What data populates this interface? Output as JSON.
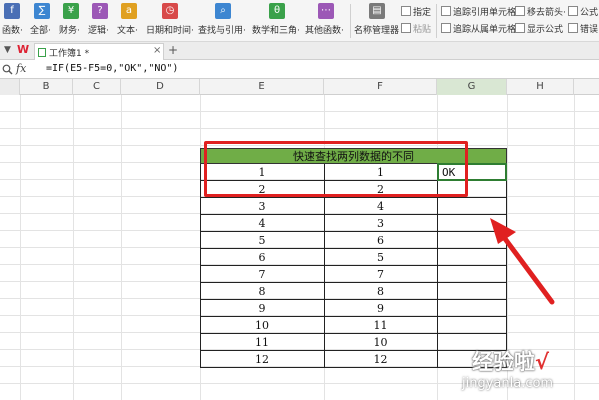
{
  "ribbon": {
    "buttons": [
      {
        "label": "函数·",
        "icon": "function-icon",
        "color": "#4a6fb5"
      },
      {
        "label": "全部·",
        "icon": "all-functions-icon",
        "color": "#3d86d1"
      },
      {
        "label": "财务·",
        "icon": "finance-icon",
        "color": "#3aa14a"
      },
      {
        "label": "逻辑·",
        "icon": "logic-icon",
        "color": "#9c58b6"
      },
      {
        "label": "文本·",
        "icon": "text-icon",
        "color": "#e0a020"
      },
      {
        "label": "日期和时间·",
        "icon": "datetime-icon",
        "color": "#d84a4a"
      },
      {
        "label": "查找与引用·",
        "icon": "lookup-icon",
        "color": "#3d86d1"
      },
      {
        "label": "数学和三角·",
        "icon": "math-icon",
        "color": "#3aa14a"
      },
      {
        "label": "其他函数·",
        "icon": "other-functions-icon",
        "color": "#9c58b6"
      },
      {
        "label": "名称管理器",
        "icon": "name-manager-icon",
        "color": "#7a7a7a"
      }
    ],
    "small": {
      "specify": "指定",
      "paste": "粘贴",
      "trace_precedents": "追踪引用单元格",
      "trace_dependents": "追踪从属单元格",
      "remove_arrows": "移去箭头·",
      "show_formulas": "显示公式",
      "formula": "公式",
      "error_check": "错误"
    }
  },
  "tabs": {
    "workbook": "工作簿1 *",
    "add": "+"
  },
  "formula_bar": {
    "fx": "fx",
    "text": "=IF(E5-F5=0,\"OK\",\"NO\")"
  },
  "columns": [
    "B",
    "C",
    "D",
    "E",
    "F",
    "G",
    "H"
  ],
  "table": {
    "title": "快速查找两列数据的不同",
    "rows": [
      [
        "1",
        "1",
        "OK"
      ],
      [
        "2",
        "2",
        ""
      ],
      [
        "3",
        "4",
        ""
      ],
      [
        "4",
        "3",
        ""
      ],
      [
        "5",
        "6",
        ""
      ],
      [
        "6",
        "5",
        ""
      ],
      [
        "7",
        "7",
        ""
      ],
      [
        "8",
        "8",
        ""
      ],
      [
        "9",
        "9",
        ""
      ],
      [
        "10",
        "11",
        ""
      ],
      [
        "11",
        "10",
        ""
      ],
      [
        "12",
        "12",
        ""
      ]
    ]
  },
  "watermark": {
    "text": "经验啦",
    "check": "√",
    "url": "jingyanla.com"
  },
  "colors": {
    "header_green": "#70ad47",
    "highlight_red": "#e02020",
    "selection_green": "#2e7d32"
  }
}
